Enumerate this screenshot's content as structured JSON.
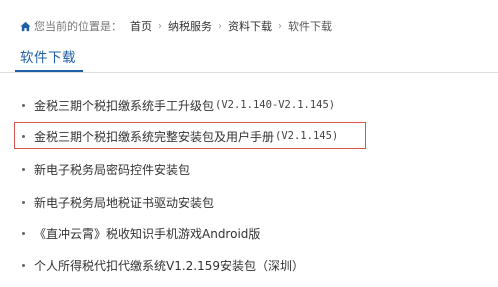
{
  "breadcrumb": {
    "prefix": "您当前的位置是：",
    "items": [
      "首页",
      "纳税服务",
      "资料下载"
    ],
    "current": "软件下载",
    "separator": "›"
  },
  "section": {
    "title": "软件下载"
  },
  "downloads": [
    {
      "title": "金税三期个税扣缴系统手工升级包",
      "version": "(V2.1.140-V2.1.145)"
    },
    {
      "title": "金税三期个税扣缴系统完整安装包及用户手册",
      "version": "(V2.1.145)"
    },
    {
      "title": "新电子税务局密码控件安装包",
      "version": ""
    },
    {
      "title": "新电子税务局地税证书驱动安装包",
      "version": ""
    },
    {
      "title": "《直冲云霄》税收知识手机游戏Android版",
      "version": ""
    },
    {
      "title": "个人所得税代扣代缴系统V1.2.159安装包（深圳）",
      "version": ""
    }
  ],
  "colors": {
    "accent": "#1f5fa6",
    "highlight_border": "#d9534f"
  }
}
